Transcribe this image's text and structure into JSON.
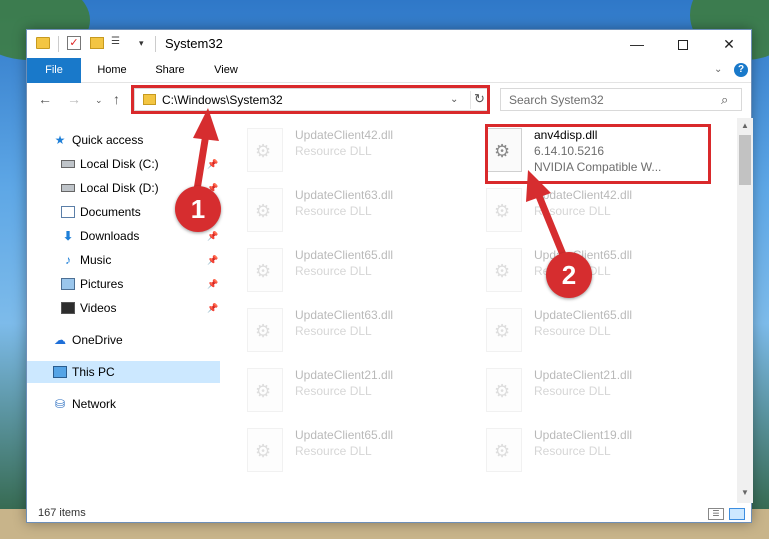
{
  "window": {
    "title": "System32",
    "controls": {
      "minimize": "—",
      "maximize": "",
      "close": "✕"
    }
  },
  "quick_access_toolbar": {
    "dropdown": "▾"
  },
  "ribbon": {
    "tabs": [
      {
        "label": "File",
        "active": true
      },
      {
        "label": "Home"
      },
      {
        "label": "Share"
      },
      {
        "label": "View"
      }
    ],
    "expand_icon": "⌄",
    "help_icon": "?"
  },
  "navigation": {
    "back": "←",
    "forward": "→",
    "recent": "⌄",
    "up": "↑",
    "address": "C:\\Windows\\System32",
    "address_dropdown": "⌄",
    "refresh": "↻",
    "search_placeholder": "Search System32",
    "search_icon": "⌕"
  },
  "sidebar": {
    "items": [
      {
        "label": "Quick access",
        "icon": "star-icon",
        "glyph": "★",
        "pinned": false
      },
      {
        "label": "Local Disk (C:)",
        "icon": "disk-icon",
        "glyph": "",
        "pinned": true
      },
      {
        "label": "Local Disk (D:)",
        "icon": "disk-icon",
        "glyph": "",
        "pinned": true
      },
      {
        "label": "Documents",
        "icon": "documents-icon",
        "glyph": "",
        "pinned": true
      },
      {
        "label": "Downloads",
        "icon": "download-icon",
        "glyph": "⬇",
        "pinned": true
      },
      {
        "label": "Music",
        "icon": "music-icon",
        "glyph": "♪",
        "pinned": true
      },
      {
        "label": "Pictures",
        "icon": "pictures-icon",
        "glyph": "",
        "pinned": true
      },
      {
        "label": "Videos",
        "icon": "videos-icon",
        "glyph": "",
        "pinned": true
      },
      {
        "label": "OneDrive",
        "icon": "cloud-icon",
        "glyph": "☁",
        "pinned": false
      },
      {
        "label": "This PC",
        "icon": "computer-icon",
        "glyph": "",
        "pinned": false,
        "selected": true
      },
      {
        "label": "Network",
        "icon": "network-icon",
        "glyph": "⛁",
        "pinned": false
      }
    ],
    "pin_glyph": "📌"
  },
  "files": {
    "highlighted": {
      "name": "anv4disp.dll",
      "version": "6.14.10.5216",
      "description": "NVIDIA Compatible W..."
    },
    "faded_left": [
      {
        "name": "UpdateClient42.dll",
        "type": "Resource DLL"
      },
      {
        "name": "UpdateClient63.dll",
        "type": "Resource DLL"
      },
      {
        "name": "UpdateClient65.dll",
        "type": "Resource DLL"
      },
      {
        "name": "UpdateClient63.dll",
        "type": "Resource DLL"
      },
      {
        "name": "UpdateClient21.dll",
        "type": "Resource DLL"
      },
      {
        "name": "UpdateClient65.dll",
        "type": "Resource DLL"
      }
    ],
    "faded_right": [
      {
        "name": "UpdateClient42.dll",
        "type": "Resource DLL"
      },
      {
        "name": "UpdateClient65.dll",
        "type": "Resource DLL"
      },
      {
        "name": "UpdateClient65.dll",
        "type": "Resource DLL"
      },
      {
        "name": "UpdateClient21.dll",
        "type": "Resource DLL"
      },
      {
        "name": "UpdateClient19.dll",
        "type": "Resource DLL"
      }
    ]
  },
  "status_bar": {
    "item_count": "167 items"
  },
  "annotations": {
    "marker1": "1",
    "marker2": "2",
    "highlight_color": "#d9292b"
  },
  "colors": {
    "accent": "#1979ca",
    "selection": "#cce8ff",
    "callout": "#d62d2f"
  }
}
